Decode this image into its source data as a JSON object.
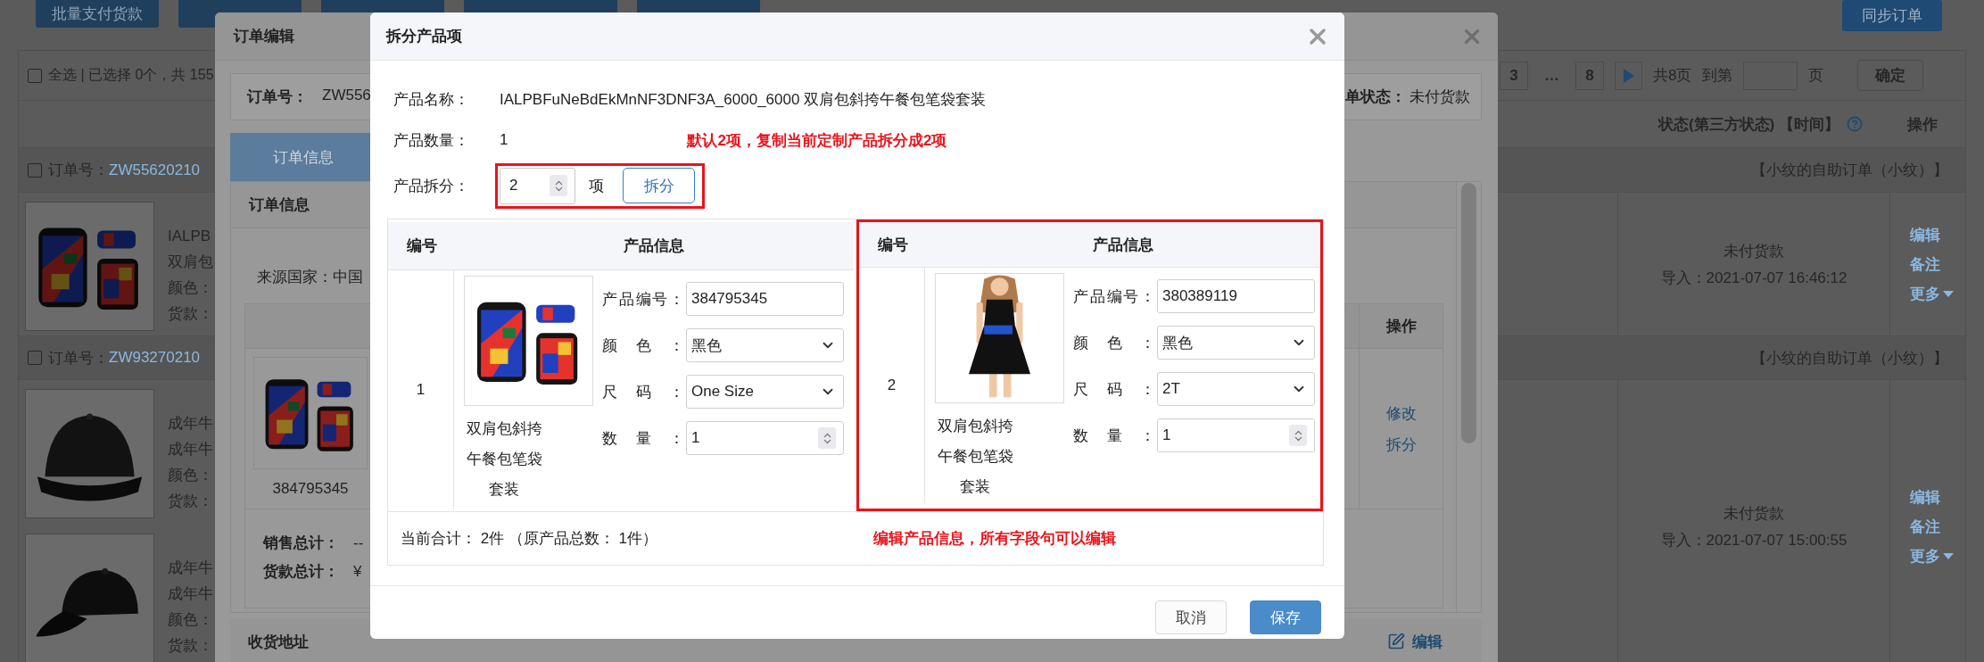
{
  "page": {
    "toolbar": [
      {
        "kind": "labeled",
        "label": "批量支付货款"
      },
      {
        "kind": "covered"
      },
      {
        "kind": "covered"
      },
      {
        "kind": "covered"
      },
      {
        "kind": "covered"
      }
    ],
    "sync_button": "同步订单",
    "select_all": {
      "checked": false,
      "label": "全选 | 已选择 0个，共 155"
    },
    "pagination": {
      "items": [
        {
          "kind": "page",
          "label": "3"
        },
        {
          "kind": "ellipsis",
          "label": "…"
        },
        {
          "kind": "page",
          "label": "8"
        }
      ],
      "total": "共8页",
      "goto_label": "到第",
      "goto_unit": "页",
      "confirm": "确定"
    },
    "columns": [
      "状态(第三方状态) 【时间】",
      "操作"
    ],
    "orders": [
      {
        "checked": false,
        "label": "订单号：",
        "number": "ZW55620210",
        "source": "【小纹的自助订单（小纹）】",
        "status": "未付货款",
        "imported": "导入：2021-07-07 16:46:12",
        "actions": [
          {
            "label": "编辑",
            "menu": false
          },
          {
            "label": "备注",
            "menu": false
          },
          {
            "label": "更多",
            "menu": true
          }
        ],
        "products": [
          {
            "kind": "backpack",
            "lines": [
              "IALPB",
              "双肩包",
              "颜色：",
              "货款："
            ]
          }
        ]
      },
      {
        "checked": false,
        "label": "订单号：",
        "number": "ZW93270210",
        "source": "【小纹的自助订单（小纹）】",
        "status": "未付货款",
        "imported": "导入：2021-07-07 15:00:55",
        "actions": [
          {
            "label": "编辑",
            "menu": false
          },
          {
            "label": "备注",
            "menu": false
          },
          {
            "label": "更多",
            "menu": true
          }
        ],
        "products": [
          {
            "kind": "hat",
            "lines": [
              "成年牛",
              "成年牛",
              "颜色：",
              "货款："
            ]
          },
          {
            "kind": "cap",
            "lines": [
              "成年牛",
              "成年牛",
              "颜色：",
              "货款："
            ]
          }
        ]
      }
    ]
  },
  "order_edit": {
    "title": "订单编辑",
    "order_label": "订单号：",
    "order_no": "ZW556",
    "status_label": "单状态：",
    "status": "未付货款",
    "tabs": [
      {
        "label": "订单信息",
        "selected": true
      }
    ],
    "section": "订单信息",
    "source": "来源国家：中国",
    "item": {
      "action_header": "操作",
      "kind": "backpack",
      "product_no": "384795345",
      "actions": [
        "修改",
        "拆分"
      ]
    },
    "totals": [
      {
        "label": "销售总计：",
        "value": "--"
      },
      {
        "label": "货款总计：",
        "value": "¥"
      }
    ],
    "address_title": "收货地址",
    "address_edit": "编辑"
  },
  "split_dialog": {
    "title": "拆分产品项",
    "fields": [
      {
        "label": "产品名称：",
        "value": "IALPBFuNeBdEkMnNF3DNF3A_6000_6000 双肩包斜挎午餐包笔袋套装"
      },
      {
        "label": "产品数量：",
        "value": "1",
        "note": "默认2项，复制当前定制产品拆分成2项"
      }
    ],
    "split": {
      "label": "产品拆分：",
      "value": "2",
      "unit": "项",
      "button": "拆分",
      "highlighted": true
    },
    "items": [
      {
        "columns": [
          "编号",
          "产品信息"
        ],
        "no": "1",
        "kind": "backpack",
        "highlighted": false,
        "name": "双肩包斜挎午餐包笔袋套装",
        "fields": [
          {
            "kind": "text",
            "label": "产品编号：",
            "value": "384795345"
          },
          {
            "kind": "select",
            "label": "颜色：",
            "value": "黑色"
          },
          {
            "kind": "select",
            "label": "尺码：",
            "value": "One Size"
          },
          {
            "kind": "number",
            "label": "数量：",
            "value": "1"
          }
        ]
      },
      {
        "columns": [
          "编号",
          "产品信息"
        ],
        "no": "2",
        "kind": "dress",
        "highlighted": true,
        "name": "双肩包斜挎午餐包笔袋套装",
        "fields": [
          {
            "kind": "text",
            "label": "产品编号：",
            "value": "380389119"
          },
          {
            "kind": "select",
            "label": "颜色：",
            "value": "黑色"
          },
          {
            "kind": "select",
            "label": "尺码：",
            "value": "2T"
          },
          {
            "kind": "number",
            "label": "数量：",
            "value": "1"
          }
        ]
      }
    ],
    "total": "当前合计：  2件  （原产品总数：  1件）",
    "edit_note": "编辑产品信息，所有字段句可以编辑",
    "buttons": [
      {
        "label": "取消",
        "kind": "default"
      },
      {
        "label": "保存",
        "kind": "primary"
      }
    ]
  }
}
